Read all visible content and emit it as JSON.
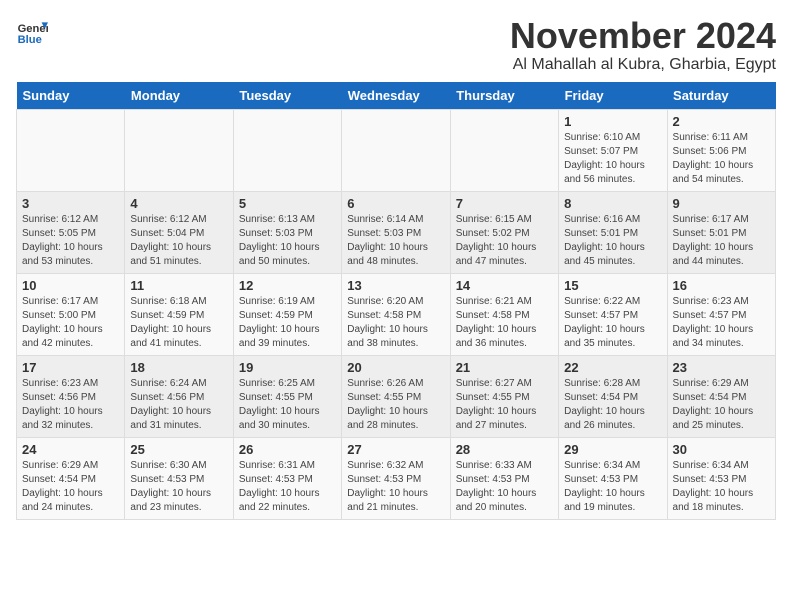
{
  "logo": {
    "general": "General",
    "blue": "Blue"
  },
  "title": {
    "month": "November 2024",
    "location": "Al Mahallah al Kubra, Gharbia, Egypt"
  },
  "headers": [
    "Sunday",
    "Monday",
    "Tuesday",
    "Wednesday",
    "Thursday",
    "Friday",
    "Saturday"
  ],
  "weeks": [
    [
      {
        "day": "",
        "info": ""
      },
      {
        "day": "",
        "info": ""
      },
      {
        "day": "",
        "info": ""
      },
      {
        "day": "",
        "info": ""
      },
      {
        "day": "",
        "info": ""
      },
      {
        "day": "1",
        "info": "Sunrise: 6:10 AM\nSunset: 5:07 PM\nDaylight: 10 hours\nand 56 minutes."
      },
      {
        "day": "2",
        "info": "Sunrise: 6:11 AM\nSunset: 5:06 PM\nDaylight: 10 hours\nand 54 minutes."
      }
    ],
    [
      {
        "day": "3",
        "info": "Sunrise: 6:12 AM\nSunset: 5:05 PM\nDaylight: 10 hours\nand 53 minutes."
      },
      {
        "day": "4",
        "info": "Sunrise: 6:12 AM\nSunset: 5:04 PM\nDaylight: 10 hours\nand 51 minutes."
      },
      {
        "day": "5",
        "info": "Sunrise: 6:13 AM\nSunset: 5:03 PM\nDaylight: 10 hours\nand 50 minutes."
      },
      {
        "day": "6",
        "info": "Sunrise: 6:14 AM\nSunset: 5:03 PM\nDaylight: 10 hours\nand 48 minutes."
      },
      {
        "day": "7",
        "info": "Sunrise: 6:15 AM\nSunset: 5:02 PM\nDaylight: 10 hours\nand 47 minutes."
      },
      {
        "day": "8",
        "info": "Sunrise: 6:16 AM\nSunset: 5:01 PM\nDaylight: 10 hours\nand 45 minutes."
      },
      {
        "day": "9",
        "info": "Sunrise: 6:17 AM\nSunset: 5:01 PM\nDaylight: 10 hours\nand 44 minutes."
      }
    ],
    [
      {
        "day": "10",
        "info": "Sunrise: 6:17 AM\nSunset: 5:00 PM\nDaylight: 10 hours\nand 42 minutes."
      },
      {
        "day": "11",
        "info": "Sunrise: 6:18 AM\nSunset: 4:59 PM\nDaylight: 10 hours\nand 41 minutes."
      },
      {
        "day": "12",
        "info": "Sunrise: 6:19 AM\nSunset: 4:59 PM\nDaylight: 10 hours\nand 39 minutes."
      },
      {
        "day": "13",
        "info": "Sunrise: 6:20 AM\nSunset: 4:58 PM\nDaylight: 10 hours\nand 38 minutes."
      },
      {
        "day": "14",
        "info": "Sunrise: 6:21 AM\nSunset: 4:58 PM\nDaylight: 10 hours\nand 36 minutes."
      },
      {
        "day": "15",
        "info": "Sunrise: 6:22 AM\nSunset: 4:57 PM\nDaylight: 10 hours\nand 35 minutes."
      },
      {
        "day": "16",
        "info": "Sunrise: 6:23 AM\nSunset: 4:57 PM\nDaylight: 10 hours\nand 34 minutes."
      }
    ],
    [
      {
        "day": "17",
        "info": "Sunrise: 6:23 AM\nSunset: 4:56 PM\nDaylight: 10 hours\nand 32 minutes."
      },
      {
        "day": "18",
        "info": "Sunrise: 6:24 AM\nSunset: 4:56 PM\nDaylight: 10 hours\nand 31 minutes."
      },
      {
        "day": "19",
        "info": "Sunrise: 6:25 AM\nSunset: 4:55 PM\nDaylight: 10 hours\nand 30 minutes."
      },
      {
        "day": "20",
        "info": "Sunrise: 6:26 AM\nSunset: 4:55 PM\nDaylight: 10 hours\nand 28 minutes."
      },
      {
        "day": "21",
        "info": "Sunrise: 6:27 AM\nSunset: 4:55 PM\nDaylight: 10 hours\nand 27 minutes."
      },
      {
        "day": "22",
        "info": "Sunrise: 6:28 AM\nSunset: 4:54 PM\nDaylight: 10 hours\nand 26 minutes."
      },
      {
        "day": "23",
        "info": "Sunrise: 6:29 AM\nSunset: 4:54 PM\nDaylight: 10 hours\nand 25 minutes."
      }
    ],
    [
      {
        "day": "24",
        "info": "Sunrise: 6:29 AM\nSunset: 4:54 PM\nDaylight: 10 hours\nand 24 minutes."
      },
      {
        "day": "25",
        "info": "Sunrise: 6:30 AM\nSunset: 4:53 PM\nDaylight: 10 hours\nand 23 minutes."
      },
      {
        "day": "26",
        "info": "Sunrise: 6:31 AM\nSunset: 4:53 PM\nDaylight: 10 hours\nand 22 minutes."
      },
      {
        "day": "27",
        "info": "Sunrise: 6:32 AM\nSunset: 4:53 PM\nDaylight: 10 hours\nand 21 minutes."
      },
      {
        "day": "28",
        "info": "Sunrise: 6:33 AM\nSunset: 4:53 PM\nDaylight: 10 hours\nand 20 minutes."
      },
      {
        "day": "29",
        "info": "Sunrise: 6:34 AM\nSunset: 4:53 PM\nDaylight: 10 hours\nand 19 minutes."
      },
      {
        "day": "30",
        "info": "Sunrise: 6:34 AM\nSunset: 4:53 PM\nDaylight: 10 hours\nand 18 minutes."
      }
    ]
  ]
}
